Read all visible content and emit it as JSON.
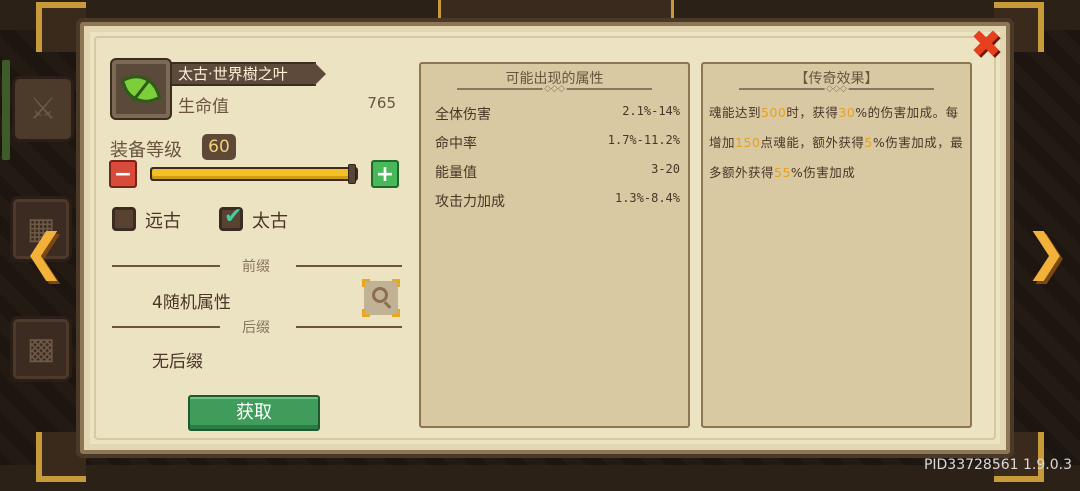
{
  "window": {
    "title_fragment": "",
    "version": "PID33728561 1.9.0.3"
  },
  "item": {
    "name": "太古·世界樹之叶",
    "icon": "leaf-icon",
    "hp_label": "生命值",
    "hp_value": "765",
    "level_label": "装备等级",
    "level_value": "60",
    "level_progress": 1.0
  },
  "rarity_filters": [
    {
      "label": "远古",
      "checked": false
    },
    {
      "label": "太古",
      "checked": true
    }
  ],
  "prefix": {
    "section_label": "前缀",
    "value": "4随机属性"
  },
  "suffix": {
    "section_label": "后缀",
    "value": "无后缀"
  },
  "acquire_label": "获取",
  "attributes": {
    "title": "可能出现的属性",
    "rows": [
      {
        "name": "全体伤害",
        "value": "2.1%-14%"
      },
      {
        "name": "命中率",
        "value": "1.7%-11.2%"
      },
      {
        "name": "能量值",
        "value": "3-20"
      },
      {
        "name": "攻击力加成",
        "value": "1.3%-8.4%"
      }
    ]
  },
  "legendary": {
    "title": "【传奇效果】",
    "segments": [
      {
        "text": "魂能达到",
        "hl": false
      },
      {
        "text": "500",
        "hl": true
      },
      {
        "text": "时，获得",
        "hl": false
      },
      {
        "text": "30",
        "hl": true
      },
      {
        "text": "%的伤害加成。每增加",
        "hl": false
      },
      {
        "text": "150",
        "hl": true
      },
      {
        "text": "点魂能，额外获得",
        "hl": false
      },
      {
        "text": "5",
        "hl": true
      },
      {
        "text": "%伤害加成，最多额外获得",
        "hl": false
      },
      {
        "text": "55",
        "hl": true
      },
      {
        "text": "%伤害加成",
        "hl": false
      }
    ]
  },
  "colors": {
    "accent_gold": "#f2b23a",
    "highlight": "#e8a020",
    "close_red": "#e8401f",
    "acquire_green": "#3f9c5a",
    "panel_bg": "#ece3c3"
  }
}
